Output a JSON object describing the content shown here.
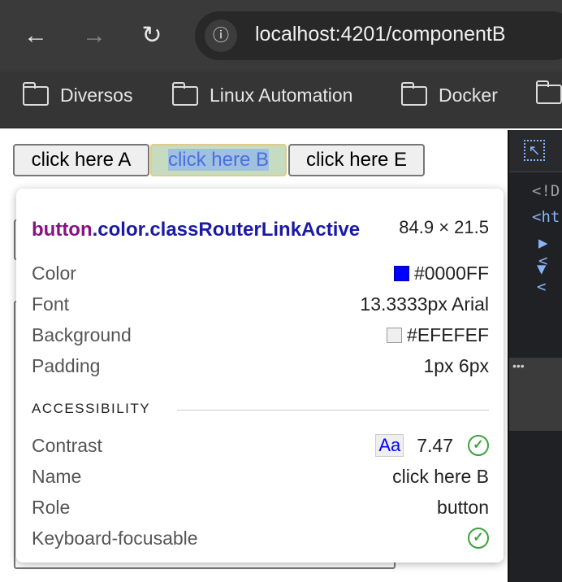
{
  "browser": {
    "url": "localhost:4201/componentB",
    "nav": {
      "back": "←",
      "forward": "→",
      "reload": "↻"
    },
    "bookmarks": [
      {
        "label": "Diversos"
      },
      {
        "label": "Linux Automation"
      },
      {
        "label": "Docker"
      }
    ]
  },
  "page": {
    "buttons": [
      {
        "label": "click here A"
      },
      {
        "label": "click here B"
      },
      {
        "label": "click here E"
      }
    ]
  },
  "tooltip": {
    "selector_tag": "button",
    "selector_classes": ".color.classRouterLinkActive",
    "dimensions": "84.9 × 21.5",
    "rows": [
      {
        "label": "Color",
        "value": "#0000FF",
        "swatch": "#0000FF"
      },
      {
        "label": "Font",
        "value": "13.3333px Arial"
      },
      {
        "label": "Background",
        "value": "#EFEFEF",
        "swatch": "#EFEFEF"
      },
      {
        "label": "Padding",
        "value": "1px 6px"
      }
    ],
    "accessibility_title": "ACCESSIBILITY",
    "contrast": {
      "label": "Contrast",
      "sample": "Aa",
      "value": "7.47"
    },
    "name": {
      "label": "Name",
      "value": "click here B"
    },
    "role": {
      "label": "Role",
      "value": "button"
    },
    "focusable": {
      "label": "Keyboard-focusable"
    }
  },
  "devtools": {
    "lines": [
      "<!D",
      "<ht",
      "▶ <",
      "▼ <"
    ],
    "more": "•••"
  },
  "colors": {
    "highlight": "#a0c0e0",
    "selected_text": "#4a6fe0",
    "success": "#3aa33a"
  }
}
